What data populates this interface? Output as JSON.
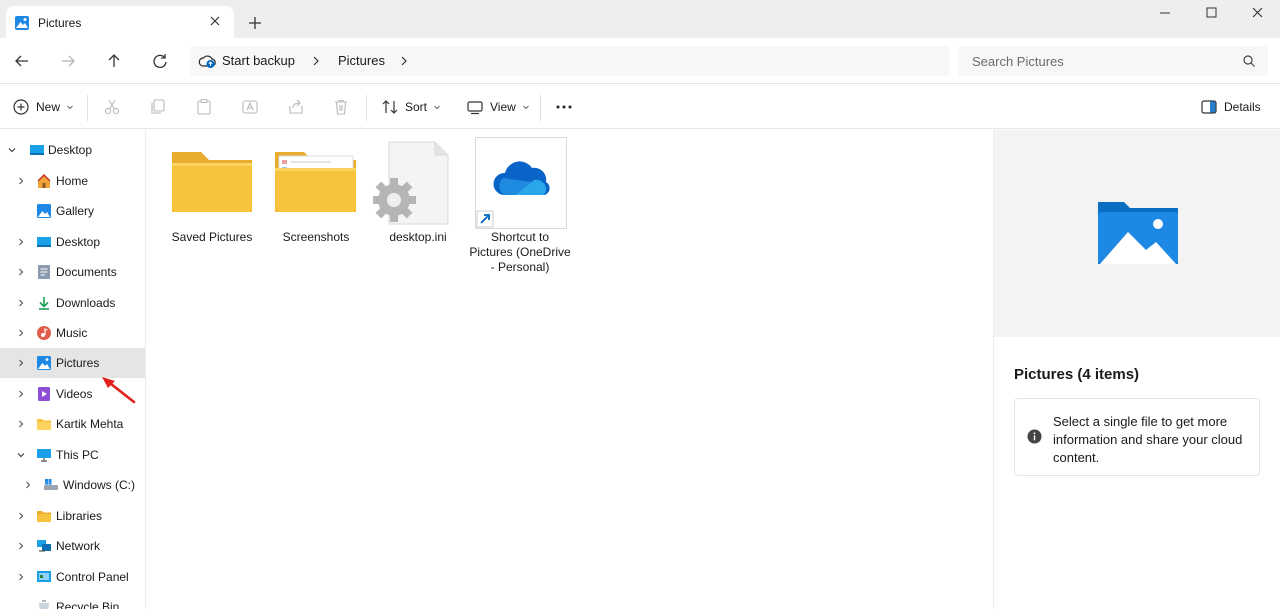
{
  "window": {
    "tab_title": "Pictures",
    "new_tab_symbol": "+"
  },
  "address": {
    "backup_label": "Start backup",
    "crumbs": [
      "Pictures"
    ],
    "search_placeholder": "Search Pictures"
  },
  "commands": {
    "new_label": "New",
    "sort_label": "Sort",
    "view_label": "View",
    "more_label": "...",
    "details_label": "Details"
  },
  "sidebar": {
    "items": [
      {
        "label": "Desktop",
        "icon": "desktop-icon",
        "expanded": true,
        "level": 0
      },
      {
        "label": "Home",
        "icon": "home-icon",
        "level": 1
      },
      {
        "label": "Gallery",
        "icon": "gallery-icon",
        "level": 1
      },
      {
        "label": "Desktop",
        "icon": "desktop-icon",
        "level": 1
      },
      {
        "label": "Documents",
        "icon": "documents-icon",
        "level": 1
      },
      {
        "label": "Downloads",
        "icon": "downloads-icon",
        "level": 1
      },
      {
        "label": "Music",
        "icon": "music-icon",
        "level": 1
      },
      {
        "label": "Pictures",
        "icon": "pictures-icon",
        "level": 1,
        "selected": true
      },
      {
        "label": "Videos",
        "icon": "videos-icon",
        "level": 1
      },
      {
        "label": "Kartik Mehta",
        "icon": "folder-icon",
        "level": 1
      },
      {
        "label": "This PC",
        "icon": "this-pc-icon",
        "level": 1,
        "expanded": true
      },
      {
        "label": "Windows (C:)",
        "icon": "drive-icon",
        "level": 2
      },
      {
        "label": "Libraries",
        "icon": "libraries-icon",
        "level": 1
      },
      {
        "label": "Network",
        "icon": "network-icon",
        "level": 1
      },
      {
        "label": "Control Panel",
        "icon": "control-panel-icon",
        "level": 1
      },
      {
        "label": "Recycle Bin",
        "icon": "recycle-bin-icon",
        "level": 1
      }
    ]
  },
  "files": [
    {
      "label": "Saved Pictures",
      "icon": "folder-icon"
    },
    {
      "label": "Screenshots",
      "icon": "folder-with-files-icon"
    },
    {
      "label": "desktop.ini",
      "icon": "settings-file-icon"
    },
    {
      "label": "Shortcut to Pictures (OneDrive - Personal)",
      "icon": "onedrive-shortcut-icon"
    }
  ],
  "details": {
    "title": "Pictures (4 items)",
    "info": "Select a single file to get more information and share your cloud content."
  },
  "colors": {
    "accent": "#0067c0",
    "folder": "#f8c33c",
    "selected_bg": "#e5e5e5",
    "annotation_arrow": "#e0231c"
  }
}
